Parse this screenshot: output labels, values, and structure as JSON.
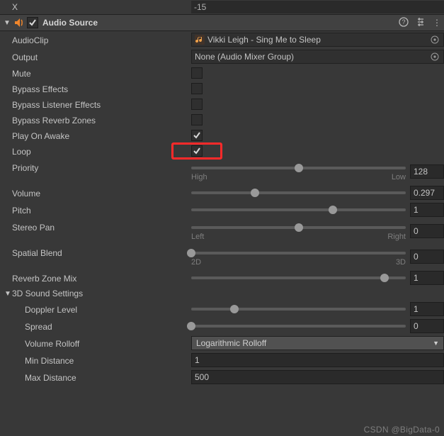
{
  "top": {
    "label": "X",
    "value": "-15"
  },
  "header": {
    "title": "Audio Source",
    "enabled": true,
    "icons": {
      "help": "?",
      "reset": "↺",
      "menu": "⋮"
    }
  },
  "fields": {
    "audioClip": {
      "label": "AudioClip",
      "value": "Vikki Leigh - Sing Me to Sleep"
    },
    "output": {
      "label": "Output",
      "value": "None (Audio Mixer Group)"
    },
    "mute": {
      "label": "Mute",
      "checked": false
    },
    "bypassEffects": {
      "label": "Bypass Effects",
      "checked": false
    },
    "bypassListener": {
      "label": "Bypass Listener Effects",
      "checked": false
    },
    "bypassReverb": {
      "label": "Bypass Reverb Zones",
      "checked": false
    },
    "playOnAwake": {
      "label": "Play On Awake",
      "checked": true
    },
    "loop": {
      "label": "Loop",
      "checked": true
    }
  },
  "sliders": {
    "priority": {
      "label": "Priority",
      "value": 128,
      "display": "128",
      "min": 0,
      "max": 256,
      "left": "High",
      "right": "Low",
      "pos": 50
    },
    "volume": {
      "label": "Volume",
      "value": 0.297,
      "display": "0.297",
      "min": 0,
      "max": 1,
      "pos": 29.7
    },
    "pitch": {
      "label": "Pitch",
      "value": 1,
      "display": "1",
      "min": -3,
      "max": 3,
      "pos": 66
    },
    "stereoPan": {
      "label": "Stereo Pan",
      "value": 0,
      "display": "0",
      "min": -1,
      "max": 1,
      "left": "Left",
      "right": "Right",
      "pos": 50
    },
    "spatial": {
      "label": "Spatial Blend",
      "value": 0,
      "display": "0",
      "min": 0,
      "max": 1,
      "left": "2D",
      "right": "3D",
      "pos": 0
    },
    "reverb": {
      "label": "Reverb Zone Mix",
      "value": 1,
      "display": "1",
      "min": 0,
      "max": 1.1,
      "pos": 90
    }
  },
  "sound3d": {
    "title": "3D Sound Settings",
    "doppler": {
      "label": "Doppler Level",
      "display": "1",
      "pos": 20
    },
    "spread": {
      "label": "Spread",
      "display": "0",
      "pos": 0
    },
    "rolloff": {
      "label": "Volume Rolloff",
      "value": "Logarithmic Rolloff"
    },
    "minDist": {
      "label": "Min Distance",
      "value": "1"
    },
    "maxDist": {
      "label": "Max Distance",
      "value": "500"
    }
  },
  "watermark": "CSDN @BigData-0"
}
